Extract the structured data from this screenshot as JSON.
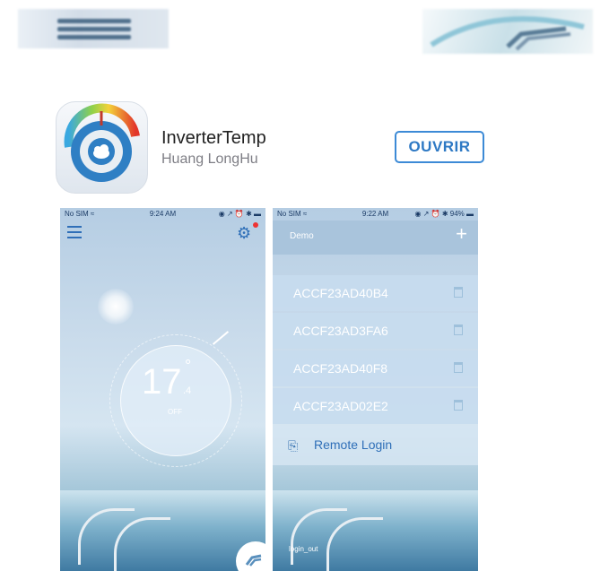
{
  "app": {
    "name": "InverterTemp",
    "developer": "Huang LongHu",
    "open_label": "OUVRIR"
  },
  "screenshot1": {
    "status": {
      "carrier": "No SIM ≈",
      "time": "9:24 AM",
      "right": "◉ ↗ ⏰ ✱ ▬"
    },
    "temperature": "17",
    "degree_symbol": "°",
    "decimal": ".4",
    "state": "OFF"
  },
  "screenshot2": {
    "status": {
      "carrier": "No SIM ≈",
      "time": "9:22 AM",
      "right": "◉ ↗ ⏰ ✱ 94% ▬"
    },
    "title": "Demo",
    "add_icon": "+",
    "devices": [
      "ACCF23AD40B4",
      "ACCF23AD3FA6",
      "ACCF23AD40F8",
      "ACCF23AD02E2"
    ],
    "remote_login": "Remote Login",
    "logout": "login_out"
  },
  "colors": {
    "accent": "#3c8ad6",
    "accent_text": "#2e79c4",
    "sky": "#b5cde3"
  },
  "icons": [
    "menu-icon",
    "gear-icon",
    "app-icon",
    "add-icon",
    "trash-icon",
    "remote-login-icon",
    "fab-icon"
  ]
}
